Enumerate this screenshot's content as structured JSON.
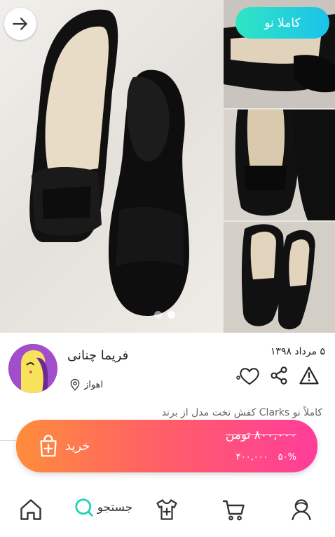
{
  "gallery": {
    "badge": "کاملا نو",
    "photo_count": 2,
    "active_photo": 1
  },
  "seller": {
    "name": "فریما چنانی",
    "city": "اهواز"
  },
  "post": {
    "date": "۵ مرداد ۱۳۹۸",
    "description": "کاملاً نو Clarks کفش تخت مدل از برند"
  },
  "buy": {
    "label": "خرید",
    "old_price": "۸۰۰,۰۰۰ تومن",
    "discount": "۵۰%",
    "new_price": "۴۰۰,۰۰۰"
  },
  "nav": {
    "search_label": "جستجو"
  },
  "colors": {
    "badge_start": "#2ee6c4",
    "badge_end": "#1cc2ea",
    "buy_start": "#ff8c3b",
    "buy_end": "#ff3d9a",
    "search_accent": "#19d3b4"
  }
}
